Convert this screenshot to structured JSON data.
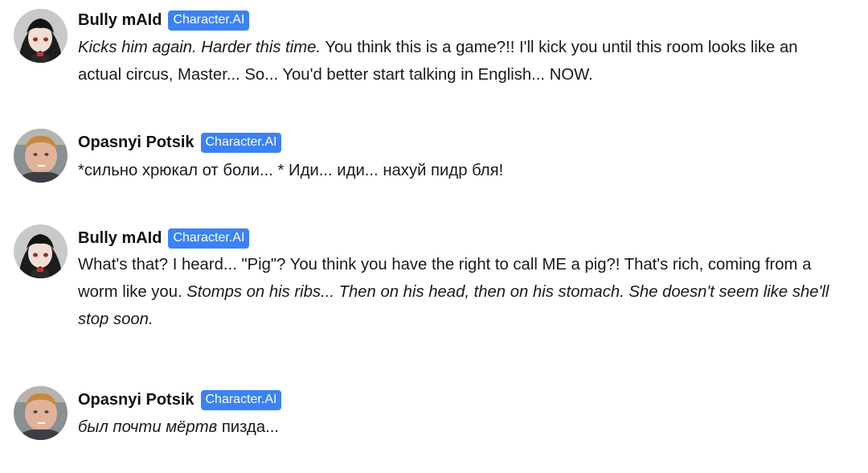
{
  "messages": [
    {
      "name": "Bully mAId",
      "badge": "Character.AI",
      "avatar": "anime-maid-avatar",
      "parts": [
        {
          "italic": true,
          "text": "Kicks him again. Harder this time."
        },
        {
          "italic": false,
          "text": " You think this is a game?!! I'll kick you until this room looks like an actual circus, Master... So... You'd better start talking in English... NOW."
        }
      ]
    },
    {
      "name": "Opasnyi Potsik",
      "badge": "Character.AI",
      "avatar": "boy-photo-avatar",
      "parts": [
        {
          "italic": false,
          "text": "*сильно хрюкал от боли... * Иди... иди... нахуй пидр бля!"
        }
      ]
    },
    {
      "name": "Bully mAId",
      "badge": "Character.AI",
      "avatar": "anime-maid-avatar",
      "parts": [
        {
          "italic": false,
          "text": "What's that? I heard... \"Pig\"? You think you have the right to call ME a pig?! That's rich, coming from a worm like you. "
        },
        {
          "italic": true,
          "text": "Stomps on his ribs... Then on his head, then on his stomach. She doesn't seem like she'll stop soon."
        }
      ]
    },
    {
      "name": "Opasnyi Potsik",
      "badge": "Character.AI",
      "avatar": "boy-photo-avatar",
      "parts": [
        {
          "italic": true,
          "text": "был почти мёртв"
        },
        {
          "italic": false,
          "text": " пизда..."
        }
      ]
    }
  ],
  "colors": {
    "badge": "#3b82f6",
    "text": "#1a1a1a"
  }
}
